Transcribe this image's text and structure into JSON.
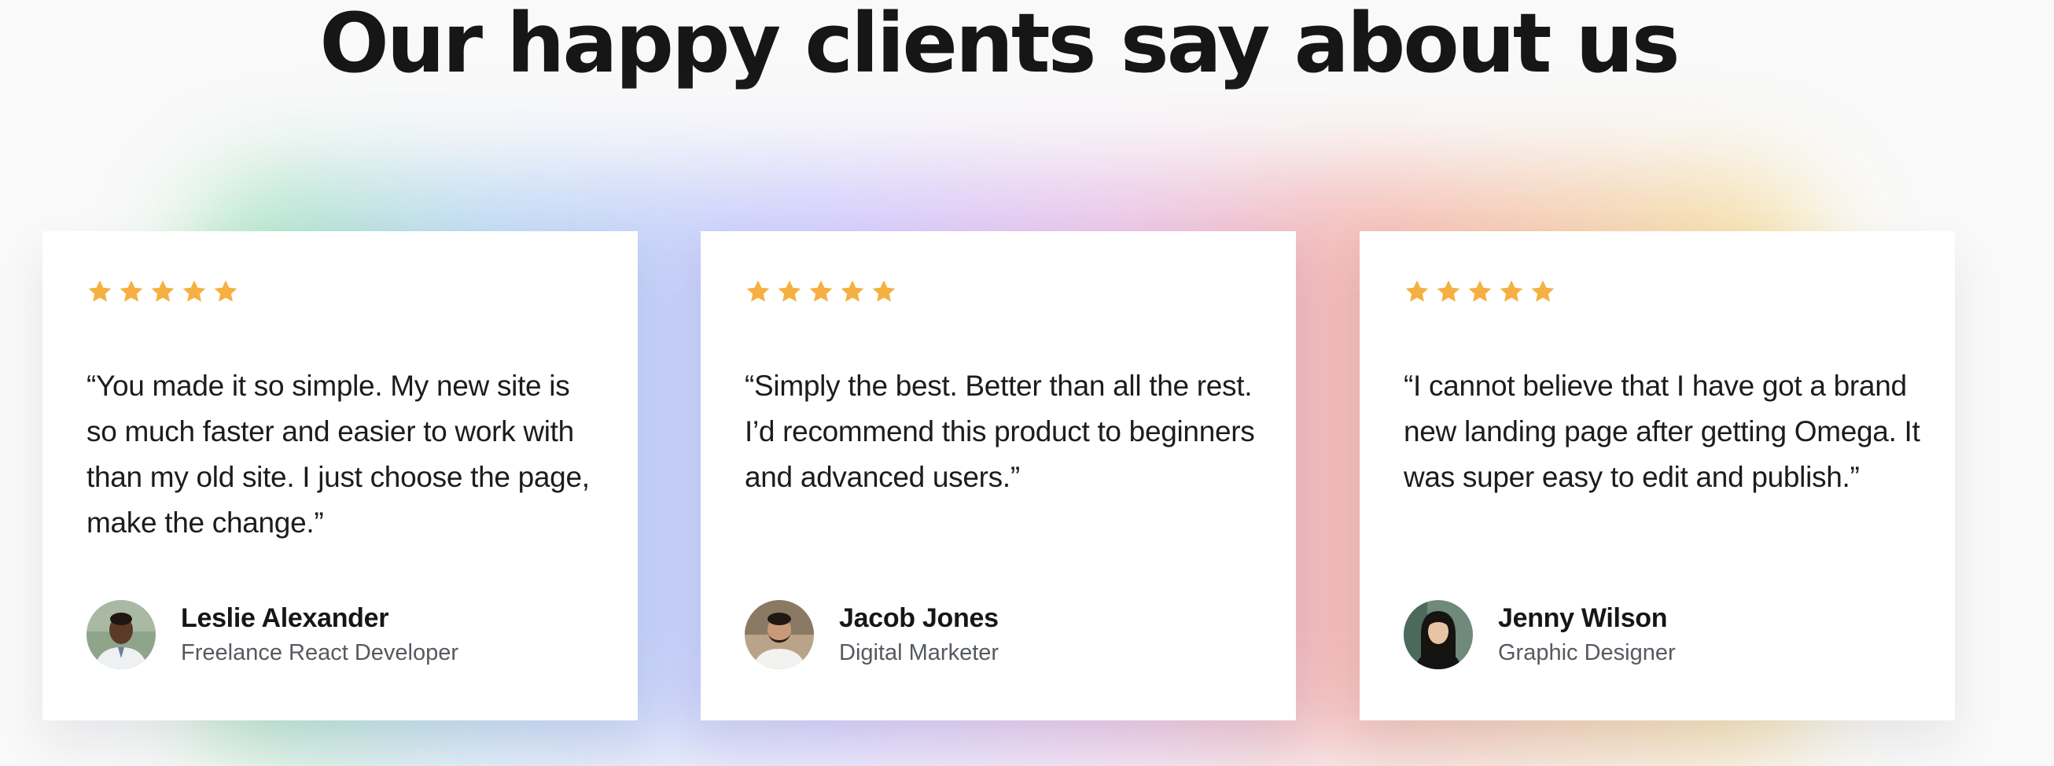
{
  "section": {
    "heading": "Our happy clients say about us"
  },
  "colors": {
    "star": "#f5b041",
    "heading": "#161616",
    "card_background": "#ffffff",
    "page_background": "#f9f9f9"
  },
  "testimonials": [
    {
      "rating": 5,
      "quote": "“You made it so simple. My new site is so much faster and easier to work with than my old site. I just choose the page, make the change.”",
      "name": "Leslie Alexander",
      "role": "Freelance React Developer",
      "avatar_icon": "avatar-photo"
    },
    {
      "rating": 5,
      "quote": "“Simply the best. Better than all the rest. I’d recommend this product to beginners and advanced users.”",
      "name": "Jacob Jones",
      "role": "Digital Marketer",
      "avatar_icon": "avatar-photo"
    },
    {
      "rating": 5,
      "quote": "“I cannot believe that I have got a brand new landing page after getting Omega. It was super easy to edit and publish.”",
      "name": "Jenny Wilson",
      "role": "Graphic Designer",
      "avatar_icon": "avatar-photo"
    }
  ]
}
